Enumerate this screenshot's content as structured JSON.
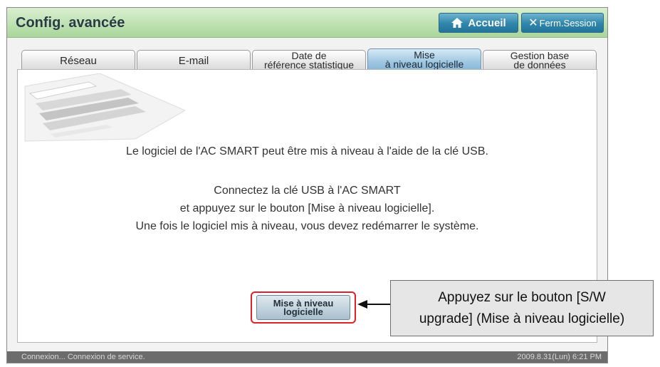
{
  "header": {
    "title": "Config. avancée",
    "home_label": "Accueil",
    "logout_label": "Ferm.Session"
  },
  "tabs": [
    {
      "lines": [
        "Réseau"
      ],
      "active": false
    },
    {
      "lines": [
        "E-mail"
      ],
      "active": false
    },
    {
      "lines": [
        "Date de",
        "référence statistique"
      ],
      "active": false
    },
    {
      "lines": [
        "Mise",
        "à niveau logicielle"
      ],
      "active": true
    },
    {
      "lines": [
        "Gestion base",
        "de données"
      ],
      "active": false
    }
  ],
  "content": {
    "line1": "Le logiciel de l'AC SMART peut être mis à niveau à l'aide de la clé USB.",
    "line2": "Connectez la clé USB à l'AC SMART",
    "line3": "et appuyez sur le bouton [Mise à niveau logicielle].",
    "line4": "Une fois le logiciel mis à niveau, vous devez redémarrer le système."
  },
  "upgrade_button": {
    "line1": "Mise à niveau",
    "line2": "logicielle"
  },
  "status": {
    "left": "Connexion... Connexion de service.",
    "right": "2009.8.31(Lun)  6:21 PM"
  },
  "callout": {
    "line1": "Appuyez sur le bouton [S/W",
    "line2": "upgrade] (Mise à niveau logicielle)"
  },
  "colors": {
    "titlebar": "#bfe2b3",
    "button": "#2f86ab",
    "active_tab": "#9fc7e2",
    "highlight": "#e0202b"
  },
  "icons": {
    "home": "home-icon",
    "close": "close-icon",
    "deco": "air-conditioner-illustration"
  }
}
